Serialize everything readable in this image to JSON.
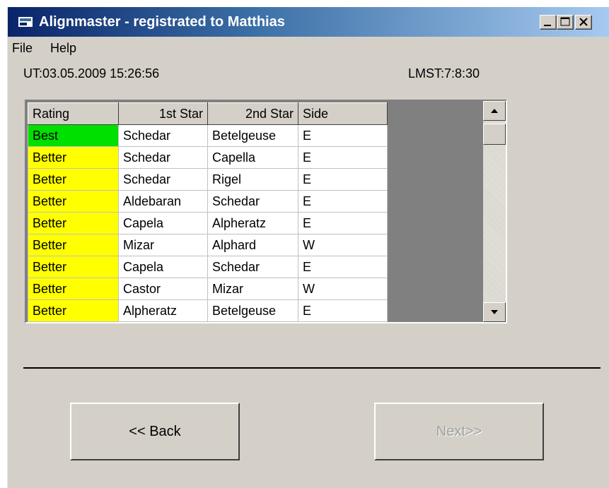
{
  "window": {
    "title": "Alignmaster - registrated to Matthias",
    "controls": [
      "minimize",
      "maximize",
      "close"
    ]
  },
  "menu": {
    "file": "File",
    "help": "Help"
  },
  "status": {
    "ut": "UT:03.05.2009 15:26:56",
    "lmst": "LMST:7:8:30"
  },
  "table": {
    "headers": {
      "rating": "Rating",
      "star1": "1st Star",
      "star2": "2nd Star",
      "side": "Side"
    },
    "rows": [
      {
        "rating": "Best",
        "star1": "Schedar",
        "star2": "Betelgeuse",
        "side": "E"
      },
      {
        "rating": "Better",
        "star1": "Schedar",
        "star2": "Capella",
        "side": "E"
      },
      {
        "rating": "Better",
        "star1": "Schedar",
        "star2": "Rigel",
        "side": "E"
      },
      {
        "rating": "Better",
        "star1": "Aldebaran",
        "star2": "Schedar",
        "side": "E"
      },
      {
        "rating": "Better",
        "star1": "Capela",
        "star2": "Alpheratz",
        "side": "E"
      },
      {
        "rating": "Better",
        "star1": "Mizar",
        "star2": "Alphard",
        "side": "W"
      },
      {
        "rating": "Better",
        "star1": "Capela",
        "star2": "Schedar",
        "side": "E"
      },
      {
        "rating": "Better",
        "star1": "Castor",
        "star2": "Mizar",
        "side": "W"
      },
      {
        "rating": "Better",
        "star1": "Alpheratz",
        "star2": "Betelgeuse",
        "side": "E"
      }
    ]
  },
  "colors": {
    "best": "#00e000",
    "better": "#ffff00"
  },
  "buttons": {
    "back": "<< Back",
    "next": "Next>>"
  }
}
